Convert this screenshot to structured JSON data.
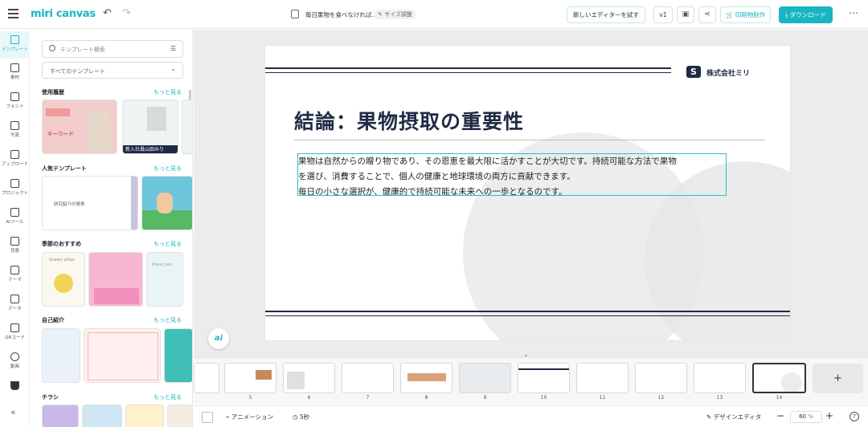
{
  "app": {
    "logo": "miri canvas",
    "doc_title": "毎日果物を食べなければ...",
    "resize_label": "サイズ調整",
    "new_editor_label": "新しいエディターを試す",
    "version_label": "v1",
    "print_label": "印刷物制作",
    "download_label": "ダウンロード"
  },
  "sidebar": {
    "items": [
      {
        "label": "テンプレート",
        "icon": "template-icon"
      },
      {
        "label": "素材",
        "icon": "elements-icon"
      },
      {
        "label": "フォント",
        "icon": "font-icon"
      },
      {
        "label": "写真",
        "icon": "photo-icon"
      },
      {
        "label": "アップロード",
        "icon": "upload-icon"
      },
      {
        "label": "プロジェクト",
        "icon": "project-icon"
      },
      {
        "label": "AIツール",
        "icon": "ai-tools-icon"
      },
      {
        "label": "背景",
        "icon": "background-icon"
      },
      {
        "label": "テーマ",
        "icon": "theme-icon"
      },
      {
        "label": "データ",
        "icon": "data-icon"
      },
      {
        "label": "QRコード",
        "icon": "qr-code-icon"
      },
      {
        "label": "動画",
        "icon": "video-icon"
      }
    ]
  },
  "panel": {
    "search_placeholder": "テンプレート検索",
    "filter_value": "すべてのテンプレート",
    "more_label": "もっと見る",
    "sections": [
      {
        "title": "使用履歴"
      },
      {
        "title": "人気テンプレート"
      },
      {
        "title": "季節のおすすめ"
      },
      {
        "title": "自己紹介"
      },
      {
        "title": "チラシ"
      }
    ],
    "thumb_texts": {
      "history_1": "キーワード",
      "history_2": "新入社員山田みり",
      "popular_1": "研究紹介の発表",
      "seasonal_1": "Green shop",
      "seasonal_2": "thank you"
    }
  },
  "slide": {
    "company": "株式会社ミリ",
    "title": "結論：果物摂取の重要性",
    "body_line1": "果物は自然からの贈り物であり、その恩恵を最大限に活かすことが大切です。持続可能な方法で果物",
    "body_line2": "を選び、消費することで、個人の健康と地球環境の両方に貢献できます。",
    "body_line3": "毎日の小さな選択が、健康的で持続可能な未来への一歩となるのです。"
  },
  "filmstrip": {
    "page_numbers": [
      "5",
      "6",
      "7",
      "8",
      "9",
      "10",
      "11",
      "12",
      "13",
      "14"
    ],
    "add_label": "+"
  },
  "bottombar": {
    "animation_label": "アニメーション",
    "duration_label": "5秒",
    "design_editor_label": "デザインエディタ",
    "zoom_value": "60",
    "zoom_unit": "%"
  },
  "colors": {
    "accent": "#19b5c2",
    "navy": "#1f2a44"
  }
}
